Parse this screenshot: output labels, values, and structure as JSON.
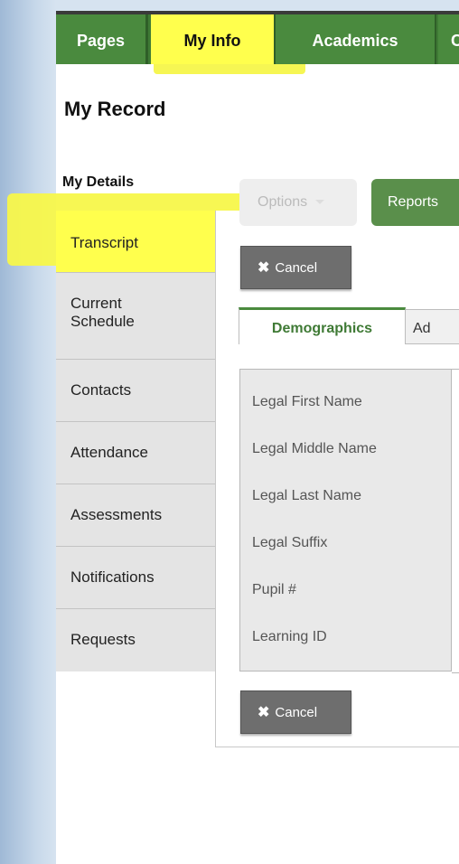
{
  "nav": {
    "tabs": [
      "Pages",
      "My Info",
      "Academics",
      "C"
    ]
  },
  "header": {
    "title": "My Record"
  },
  "sidebar": {
    "heading": "My Details",
    "items": [
      {
        "label": "Transcript"
      },
      {
        "label": "Current\nSchedule"
      },
      {
        "label": "Contacts"
      },
      {
        "label": "Attendance"
      },
      {
        "label": "Assessments"
      },
      {
        "label": "Notifications"
      },
      {
        "label": "Requests"
      }
    ]
  },
  "toolbar": {
    "options_label": "Options",
    "reports_label": "Reports",
    "cancel_label": "Cancel"
  },
  "detail_tabs": [
    "Demographics",
    "Ad"
  ],
  "fields": [
    "Legal First Name",
    "Legal Middle Name",
    "Legal Last Name",
    "Legal Suffix",
    "Pupil #",
    "Learning ID"
  ],
  "highlight_color": "#ffff4d",
  "accent_color": "#4a8a3e"
}
